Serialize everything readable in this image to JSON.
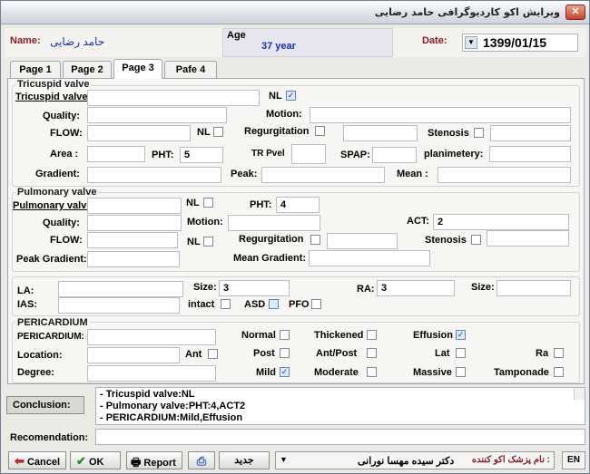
{
  "window": {
    "title": "ویرایش اکو کاردیوگرافی حامد رضایی",
    "close": "✕"
  },
  "header": {
    "name_label": "Name:",
    "name_value": "حامد رضايى",
    "age_label": "Age",
    "age_value": "37 year",
    "date_label": "Date:",
    "date_value": "1399/01/15"
  },
  "tabs": [
    "Page 1",
    "Page 2",
    "Page 3",
    "Pafe 4"
  ],
  "tricuspid": {
    "title": "Tricuspid valve",
    "valve_label": "Tricuspid valve :",
    "valve_value": "",
    "nl_label": "NL",
    "nl_checked": "✓",
    "quality_label": "Quality:",
    "motion_label": "Motion:",
    "flow_label": "FLOW:",
    "flow_nl_label": "NL",
    "regurg_label": "Regurgitation",
    "stenosis_label": "Stenosis",
    "area_label": "Area :",
    "pht_label": "PHT:",
    "pht_value": "5",
    "tr_pvel_label": "TR Pvel",
    "spap_label": "SPAP:",
    "planimetery_label": "planimetery:",
    "gradient_label": "Gradient:",
    "peak_label": "Peak:",
    "mean_label": "Mean :"
  },
  "pulmonary": {
    "title": "Pulmonary valve",
    "valve_label": "Pulmonary valve:",
    "nl_label": "NL",
    "pht_label": "PHT:",
    "pht_value": "4",
    "quality_label": "Quality:",
    "motion_label": "Motion:",
    "act_label": "ACT:",
    "act_value": "2",
    "flow_label": "FLOW:",
    "flow_nl_label": "NL",
    "regurg_label": "Regurgitation",
    "stenosis_label": "Stenosis",
    "peak_grad_label": "Peak Gradient:",
    "mean_grad_label": "Mean Gradient:"
  },
  "atria": {
    "la_label": "LA:",
    "size_label": "Size:",
    "size_value": "3",
    "ra_label": "RA:",
    "ra_value": "3",
    "size2_label": "Size:",
    "ias_label": "IAS:",
    "intact_label": "intact",
    "asd_label": "ASD",
    "pfo_label": "PFO"
  },
  "pericardium": {
    "title": "PERICARDIUM",
    "pericardium_label": "PERICARDIUM:",
    "location_label": "Location:",
    "ant_label": "Ant",
    "degree_label": "Degree:",
    "normal_label": "Normal",
    "thickened_label": "Thickened",
    "effusion_label": "Effusion",
    "effusion_checked": "✓",
    "post_label": "Post",
    "antpost_label": "Ant/Post",
    "lat_label": "Lat",
    "ra_label": "Ra",
    "mild_label": "Mild",
    "mild_checked": "✓",
    "moderate_label": "Moderate",
    "massive_label": "Massive",
    "tamponade_label": "Tamponade"
  },
  "conclusion": {
    "label": "Conclusion:",
    "lines": [
      "- Tricuspid valve:NL",
      "- Pulmonary valve:PHT:4,ACT2",
      "- PERICARDIUM:Mild,Effusion"
    ]
  },
  "recomendation_label": "Recomendation:",
  "footer": {
    "cancel": "Cancel",
    "ok": "OK",
    "report": "Report",
    "new": "جديد",
    "doctor_label": "نام پزشک اکو کننده :",
    "doctor_value": "دکتر سیده مهسا نورانی",
    "lang": "EN"
  },
  "colors": {
    "accent_label": "#8b1a2b",
    "name_value": "#1f2fb5",
    "age_value": "#1f2fb5"
  }
}
